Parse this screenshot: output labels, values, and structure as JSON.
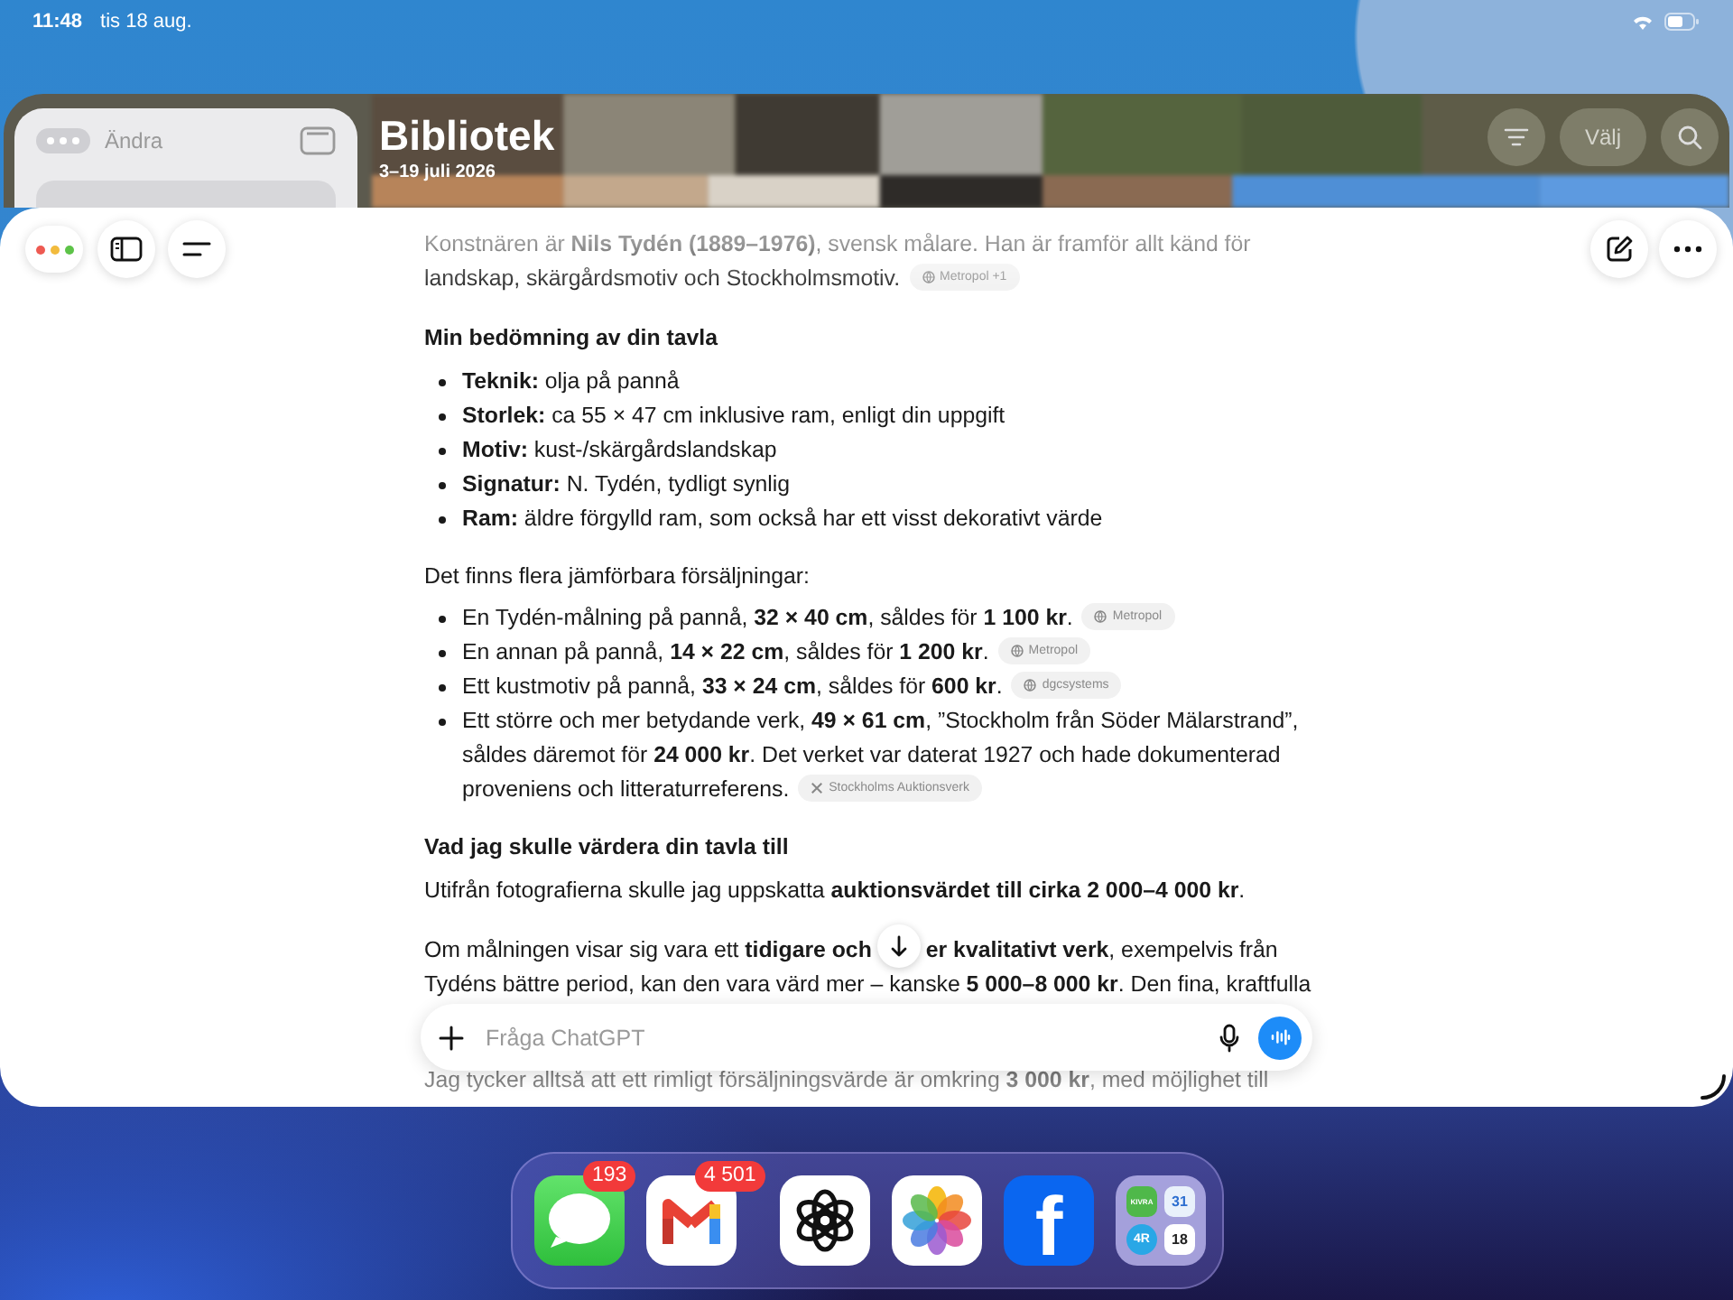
{
  "status_bar": {
    "time": "11:48",
    "date": "tis 18 aug."
  },
  "photos_window": {
    "edit": "Ändra",
    "title": "Bibliotek",
    "subtitle": "3–19 juli 2026",
    "select": "Välj"
  },
  "chat": {
    "blocks": [
      {
        "kind": "paragraph",
        "text": "Konstnären är **Nils Tydén (1889–1976)**, svensk målare. Han är framför allt känd för landskap, skärgårdsmotiv och Stockholmsmotiv.",
        "source": {
          "label": "Metropol +1",
          "kind": "web"
        }
      },
      {
        "kind": "heading",
        "text": "Min bedömning av din tavla"
      },
      {
        "kind": "list",
        "items": [
          {
            "text": "**Teknik:** olja på pannå"
          },
          {
            "text": "**Storlek:** ca 55 × 47 cm inklusive ram, enligt din uppgift"
          },
          {
            "text": "**Motiv:** kust-/skärgårdslandskap"
          },
          {
            "text": "**Signatur:** N. Tydén, tydligt synlig"
          },
          {
            "text": "**Ram:** äldre förgylld ram, som också har ett visst dekorativt värde"
          }
        ]
      },
      {
        "kind": "paragraph",
        "text": "Det finns flera jämförbara försäljningar:"
      },
      {
        "kind": "list",
        "items": [
          {
            "text": "En Tydén-målning på pannå, **32 × 40 cm**, såldes för **1 100 kr**.",
            "source": {
              "label": "Metropol",
              "kind": "web"
            }
          },
          {
            "text": "En annan på pannå, **14 × 22 cm**, såldes för **1 200 kr**.",
            "source": {
              "label": "Metropol",
              "kind": "web"
            }
          },
          {
            "text": "Ett kustmotiv på pannå, **33 × 24 cm**, såldes för **600 kr**.",
            "source": {
              "label": "dgcsystems",
              "kind": "web"
            }
          },
          {
            "text": "Ett större och mer betydande verk, **49 × 61 cm**, ”Stockholm från Söder Mälarstrand”, såldes däremot för **24 000 kr**. Det verket var daterat 1927 och hade dokumenterad proveniens och litteraturreferens.",
            "source": {
              "label": "Stockholms Auktionsverk",
              "kind": "auction_house"
            }
          }
        ]
      },
      {
        "kind": "heading",
        "text": "Vad jag skulle värdera din tavla till"
      },
      {
        "kind": "paragraph",
        "text": "Utifrån fotografierna skulle jag uppskatta **auktionsvärdet till cirka 2 000–4 000 kr**."
      },
      {
        "kind": "paragraph",
        "text": "Om målningen visar sig vara ett **tidigare och**",
        "scroll_button": true,
        "text_after": "**er kvalitativt verk**, exempelvis från Tydéns bättre period, kan den vara värd mer – kanske **5 000–8 000 kr**. Den fina, kraftfulla"
      },
      {
        "kind": "paragraph",
        "text": "Jag tycker alltså att ett rimligt försäljningsvärde är omkring **3 000 kr**, med möjlighet till"
      }
    ],
    "composer": {
      "placeholder": "Fråga ChatGPT"
    }
  },
  "dock": {
    "apps": [
      {
        "kind": "messages",
        "badge": "193"
      },
      {
        "kind": "gmail",
        "badge": "4 501"
      },
      {
        "kind": "chatgpt"
      },
      {
        "kind": "photos"
      },
      {
        "kind": "facebook",
        "glyph": "f"
      },
      {
        "kind": "folder",
        "tiles": [
          "KIVRA",
          "31",
          "4R",
          "18"
        ]
      }
    ]
  }
}
